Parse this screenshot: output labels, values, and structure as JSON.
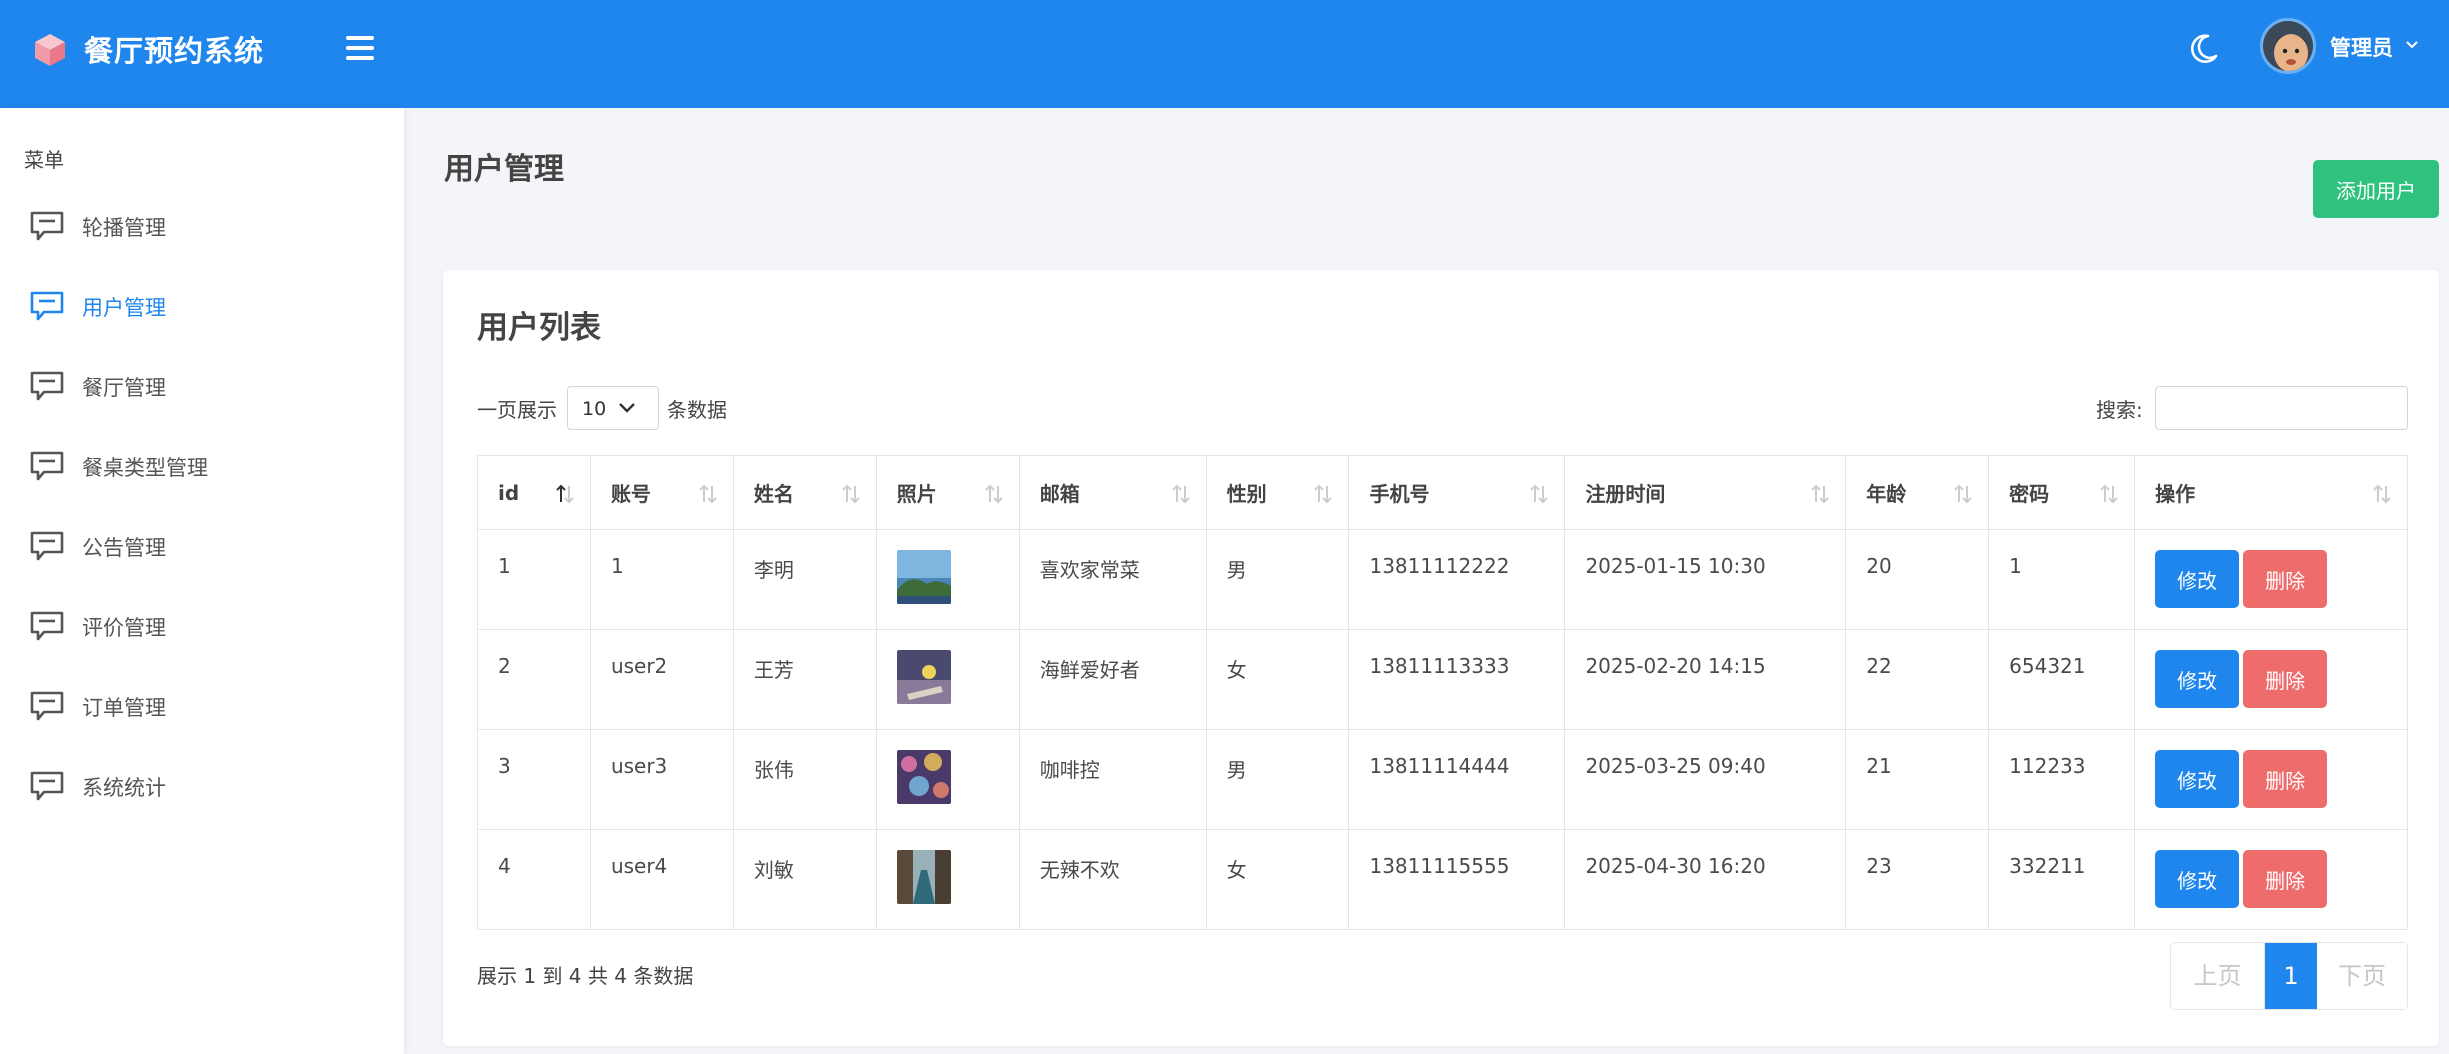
{
  "header": {
    "app_title": "餐厅预约系统",
    "user_name": "管理员",
    "brand_color": "#1e86ec"
  },
  "sidebar": {
    "menu_title": "菜单",
    "items": [
      {
        "label": "轮播管理",
        "icon": "message-icon",
        "active": false
      },
      {
        "label": "用户管理",
        "icon": "message-icon",
        "active": true
      },
      {
        "label": "餐厅管理",
        "icon": "message-icon",
        "active": false
      },
      {
        "label": "餐桌类型管理",
        "icon": "message-icon",
        "active": false
      },
      {
        "label": "公告管理",
        "icon": "message-icon",
        "active": false
      },
      {
        "label": "评价管理",
        "icon": "message-icon",
        "active": false
      },
      {
        "label": "订单管理",
        "icon": "message-icon",
        "active": false
      },
      {
        "label": "系统统计",
        "icon": "message-icon",
        "active": false
      }
    ]
  },
  "page": {
    "title": "用户管理",
    "add_button": "添加用户"
  },
  "card": {
    "title": "用户列表",
    "length_pre": "一页展示",
    "length_value": "10",
    "length_post": "条数据",
    "search_label": "搜索:",
    "search_value": ""
  },
  "table": {
    "columns": [
      "id",
      "账号",
      "姓名",
      "照片",
      "邮箱",
      "性别",
      "手机号",
      "注册时间",
      "年龄",
      "密码",
      "操作"
    ],
    "rows": [
      {
        "id": "1",
        "account": "1",
        "name": "李明",
        "photo": "coast-photo",
        "email": "喜欢家常菜",
        "gender": "男",
        "phone": "13811112222",
        "registered": "2025-01-15 10:30",
        "age": "20",
        "password": "1"
      },
      {
        "id": "2",
        "account": "user2",
        "name": "王芳",
        "photo": "flower-photo",
        "email": "海鲜爱好者",
        "gender": "女",
        "phone": "13811113333",
        "registered": "2025-02-20 14:15",
        "age": "22",
        "password": "654321"
      },
      {
        "id": "3",
        "account": "user3",
        "name": "张伟",
        "photo": "bokeh-photo",
        "email": "咖啡控",
        "gender": "男",
        "phone": "13811114444",
        "registered": "2025-03-25 09:40",
        "age": "21",
        "password": "112233"
      },
      {
        "id": "4",
        "account": "user4",
        "name": "刘敏",
        "photo": "street-photo",
        "email": "无辣不欢",
        "gender": "女",
        "phone": "13811115555",
        "registered": "2025-04-30 16:20",
        "age": "23",
        "password": "332211"
      }
    ],
    "edit_label": "修改",
    "delete_label": "删除"
  },
  "footer": {
    "info": "展示 1 到 4 共 4 条数据",
    "prev": "上页",
    "current": "1",
    "next": "下页"
  }
}
